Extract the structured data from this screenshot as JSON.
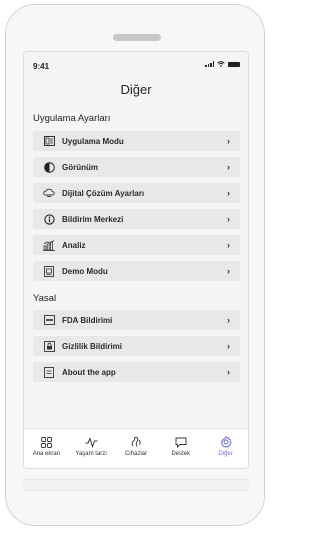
{
  "status": {
    "time": "9:41"
  },
  "page": {
    "title": "Diğer"
  },
  "sections": [
    {
      "header": "Uygulama Ayarları",
      "items": [
        {
          "label": "Uygulama Modu",
          "icon": "app-mode-icon"
        },
        {
          "label": "Görünüm",
          "icon": "appearance-icon"
        },
        {
          "label": "Dijital Çözüm Ayarları",
          "icon": "digital-solution-icon"
        },
        {
          "label": "Bildirim Merkezi",
          "icon": "info-icon"
        },
        {
          "label": "Analiz",
          "icon": "analytics-icon"
        },
        {
          "label": "Demo Modu",
          "icon": "demo-icon"
        }
      ]
    },
    {
      "header": "Yasal",
      "items": [
        {
          "label": "FDA Bildirimi",
          "icon": "fda-icon"
        },
        {
          "label": "Gizlilik Bildirimi",
          "icon": "privacy-icon"
        },
        {
          "label": "About the app",
          "icon": "about-icon"
        }
      ]
    }
  ],
  "chevron": "›",
  "tabbar": {
    "active_color": "#6a6fd6",
    "tabs": [
      {
        "label": "Ana ekran",
        "icon": "home-grid-icon"
      },
      {
        "label": "Yaşam tarzı",
        "icon": "lifestyle-wave-icon"
      },
      {
        "label": "Cihazlar",
        "icon": "devices-icon"
      },
      {
        "label": "Destek",
        "icon": "support-chat-icon"
      },
      {
        "label": "Diğer",
        "icon": "settings-gear-icon",
        "active": true
      }
    ]
  }
}
